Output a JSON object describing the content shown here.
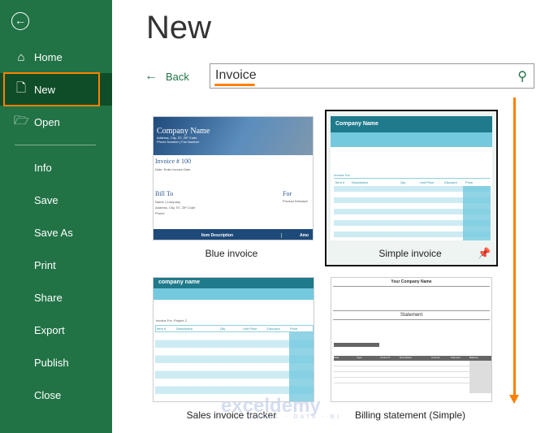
{
  "sidebar": {
    "items": [
      {
        "label": "Home",
        "icon": "home-icon"
      },
      {
        "label": "New",
        "icon": "new-file-icon",
        "selected": true
      },
      {
        "label": "Open",
        "icon": "folder-open-icon"
      },
      {
        "label": "Info"
      },
      {
        "label": "Save"
      },
      {
        "label": "Save As"
      },
      {
        "label": "Print"
      },
      {
        "label": "Share"
      },
      {
        "label": "Export"
      },
      {
        "label": "Publish"
      },
      {
        "label": "Close"
      }
    ]
  },
  "header": {
    "title": "New",
    "back_label": "Back"
  },
  "search": {
    "value": "Invoice"
  },
  "templates": [
    {
      "label": "Blue invoice",
      "company": "Company Name",
      "address": "Address, City, ST, ZIP Code",
      "phone": "Phone Number | Fax Number",
      "invoice": "Invoice # 100",
      "date": "Date: Enter Invoice Date",
      "bill_to": "Bill To",
      "for": "For",
      "bill_lines": "Name | Company",
      "bill_addr": "Address, City, ST, ZIP Code",
      "bill_phone": "Phone",
      "product": "Product Descripti",
      "col1": "Item Description",
      "col2": "Amo"
    },
    {
      "label": "Simple invoice",
      "company": "Company Name",
      "invoice_for": "Invoice For:",
      "cols": [
        "Item #",
        "Description",
        "Qty",
        "Unit Price",
        "Discount",
        "Price"
      ],
      "selected": true
    },
    {
      "label": "Sales invoice tracker",
      "company": "company name",
      "invoice_for": "Invoice For: Project 2",
      "cols": [
        "Item #",
        "Description",
        "Qty",
        "Unit Price",
        "Discount",
        "Price"
      ]
    },
    {
      "label": "Billing statement (Simple)",
      "company": "Your Company Name",
      "statement": "Statement",
      "cols": [
        "Date",
        "Type",
        "Invoice #",
        "Description",
        "Amount",
        "Payment",
        "Balance"
      ]
    }
  ],
  "watermark": {
    "name": "exceldemy",
    "tagline": "EXCEL · DATA · BI"
  },
  "colors": {
    "sidebar": "#217346",
    "selected": "#0e4d27",
    "highlight": "#ff8000",
    "teal": "#1f7a8c"
  }
}
